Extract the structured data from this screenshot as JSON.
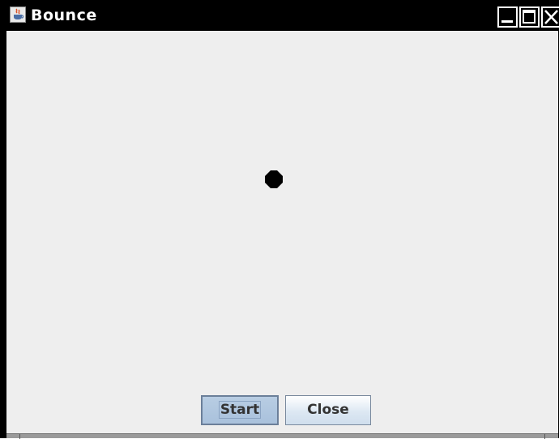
{
  "window": {
    "title": "Bounce",
    "icon": "java-cup-icon",
    "controls": {
      "minimize_icon": "minimize-icon",
      "maximize_icon": "maximize-icon",
      "close_icon": "close-icon"
    }
  },
  "canvas": {
    "background": "#eeeeee",
    "ball_color": "#000000"
  },
  "buttons": {
    "start_label": "Start",
    "close_label": "Close"
  },
  "colors": {
    "titlebar": "#000000",
    "title_text": "#ffffff",
    "start_button": "#b8cde3",
    "close_button": "#dde8f3"
  }
}
